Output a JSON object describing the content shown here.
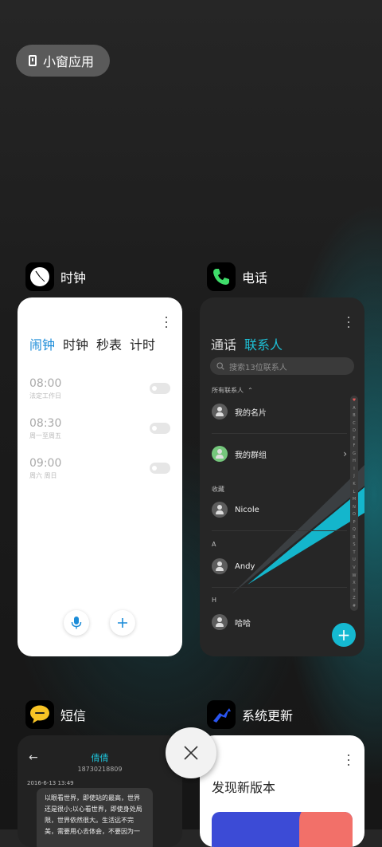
{
  "floating_window": {
    "label": "小窗应用"
  },
  "apps": {
    "clock": {
      "name": "时钟",
      "tabs": [
        "闹钟",
        "时钟",
        "秒表",
        "计时"
      ],
      "active_tab": 0,
      "alarms": [
        {
          "time": "08:00",
          "repeat": "法定工作日",
          "enabled": false
        },
        {
          "time": "08:30",
          "repeat": "周一至周五",
          "enabled": false
        },
        {
          "time": "09:00",
          "repeat": "周六 周日",
          "enabled": false
        }
      ]
    },
    "phone": {
      "name": "电话",
      "tabs": [
        "通话",
        "联系人"
      ],
      "active_tab": 1,
      "search_placeholder": "搜索13位联系人",
      "all_contacts_label": "所有联系人",
      "sections": {
        "favorites": "收藏",
        "a": "A",
        "h": "H"
      },
      "contacts": {
        "my_card": "我的名片",
        "my_groups": "我的群组",
        "nicole": "Nicole",
        "andy": "Andy",
        "haha": "哈哈"
      },
      "alphabet": [
        "♥",
        "A",
        "B",
        "C",
        "D",
        "E",
        "F",
        "G",
        "H",
        "I",
        "J",
        "K",
        "L",
        "M",
        "N",
        "O",
        "P",
        "Q",
        "R",
        "S",
        "T",
        "U",
        "V",
        "W",
        "X",
        "Y",
        "Z",
        "#"
      ]
    },
    "messages": {
      "name": "短信",
      "contact_name": "倩倩",
      "contact_number": "18730218809",
      "timestamp": "2016-6-13 13:49",
      "message_text": "以眼看世界，即使站的最高，世界还是很小;以心看世界，即使身处局限，世界依然很大。生活远不完美，需要用心去体会，不要因为一"
    },
    "system_update": {
      "name": "系统更新",
      "title": "发现新版本"
    }
  },
  "colors": {
    "accent_clock": "#1b8cd8",
    "accent_phone": "#1ec0d6",
    "fab": "#15b9d1"
  }
}
